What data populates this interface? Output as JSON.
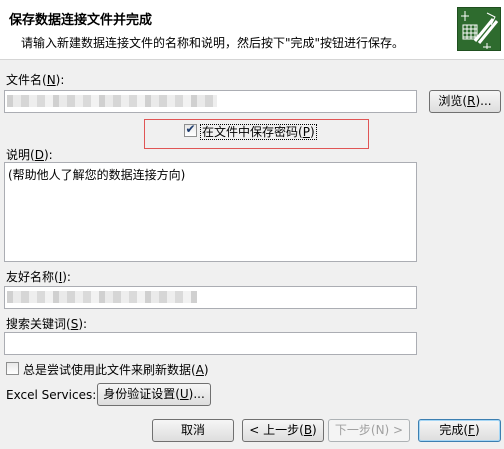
{
  "dialog": {
    "title": "保存数据连接文件并完成",
    "subtitle": "请输入新建数据连接文件的名称和说明，然后按下\"完成\"按钮进行保存。",
    "header_icon": "data-connection-wizard-icon"
  },
  "filename": {
    "label": "文件名(",
    "key": "N",
    "label_end": "):",
    "value": "",
    "browse_label": "浏览(",
    "browse_key": "R",
    "browse_end": ")..."
  },
  "save_password": {
    "label": "在文件中保存密码(",
    "key": "P",
    "label_end": ")",
    "checked": true
  },
  "description": {
    "label": "说明(",
    "key": "D",
    "label_end": "):",
    "value": "(帮助他人了解您的数据连接方向)"
  },
  "friendly_name": {
    "label": "友好名称(",
    "key": "I",
    "label_end": "):",
    "value": ""
  },
  "keywords": {
    "label": "搜索关键词(",
    "key": "S",
    "label_end": "):",
    "value": ""
  },
  "always_refresh": {
    "label": "总是尝试使用此文件来刷新数据(",
    "key": "A",
    "label_end": ")",
    "checked": false
  },
  "excel_services": {
    "label": "Excel Services:",
    "auth_button": "身份验证设置(",
    "auth_key": "U",
    "auth_end": ")..."
  },
  "footer": {
    "cancel": "取消",
    "back": "< 上一步(",
    "back_key": "B",
    "back_end": ")",
    "next": "下一步(N) >",
    "finish": "完成(",
    "finish_key": "F",
    "finish_end": ")"
  }
}
